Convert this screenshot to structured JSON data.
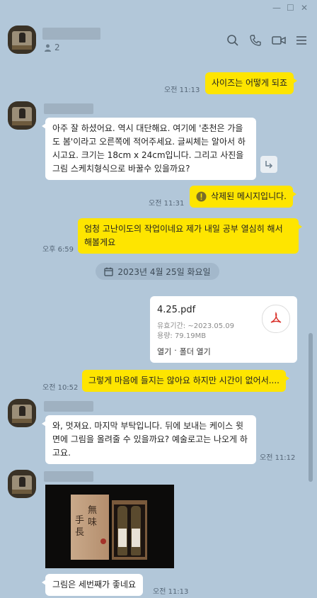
{
  "window": {
    "minimize": "—",
    "maximize": "☐",
    "close": "✕"
  },
  "header": {
    "member_count": "2"
  },
  "messages": [
    {
      "id": "m1",
      "text": "사이즈는 어떻게 되죠",
      "time": "오전 11:13"
    },
    {
      "id": "m2",
      "text": "아주 잘 하셨어요. 역시 대단해요. 여기에 '춘천은 가을도 봄'이라고 오른쪽에 적어주세요. 글씨체는 알아서 하시고요. 크기는 18cm x 24cm입니다. 그리고 사진을 그림 스케치형식으로  바꿀수 있을까요?"
    },
    {
      "id": "m3",
      "text": "삭제된 메시지입니다.",
      "time": "오전 11:31"
    },
    {
      "id": "m4",
      "text": "엄청 고난이도의 작업이네요 제가 내일 공부 열심히 해서 해볼게요",
      "time": "오후 6:59"
    },
    {
      "id": "m6",
      "text": "그렇게 마음에 들지는 않아요 하지만 시간이 없어서....",
      "time": "오전 10:52"
    },
    {
      "id": "m7",
      "text": "와, 멋져요. 마지막 부탁입니다. 뒤에 보내는 케이스 윗면에 그림을 올려줄 수 있을까요? 예술로고는 나오게 하고요.",
      "time": "오전 11:12"
    },
    {
      "id": "m8",
      "text": "그림은 세번째가 좋네요",
      "time": "오전 11:13"
    }
  ],
  "date_divider": "2023년 4월 25일 화요일",
  "file": {
    "name": "4.25.pdf",
    "expiry": "유효기간: ~2023.05.09",
    "size": "용량: 79.19MB",
    "open": "열기",
    "sep": "·",
    "open_folder": "폴더 열기"
  },
  "photo": {
    "left_text": "手長",
    "right_text": "無味"
  }
}
